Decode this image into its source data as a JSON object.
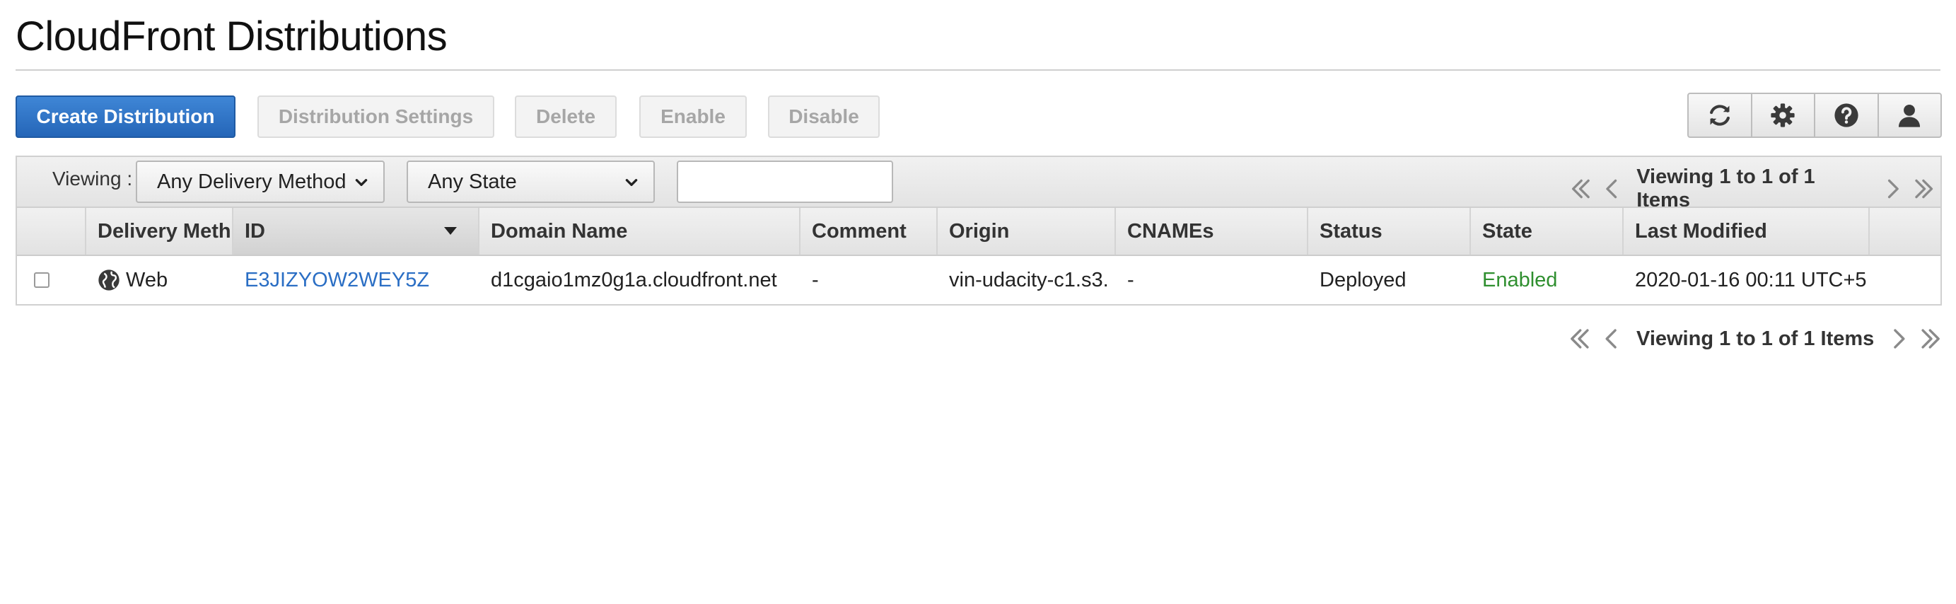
{
  "page": {
    "title": "CloudFront Distributions"
  },
  "toolbar": {
    "create_label": "Create Distribution",
    "settings_label": "Distribution Settings",
    "delete_label": "Delete",
    "enable_label": "Enable",
    "disable_label": "Disable",
    "icons": [
      "refresh-icon",
      "gear-icon",
      "help-icon",
      "user-icon"
    ]
  },
  "filters": {
    "viewing_label": "Viewing :",
    "delivery_method": "Any Delivery Method",
    "state": "Any State",
    "search_value": "",
    "search_placeholder": ""
  },
  "pagination": {
    "summary": "Viewing 1 to 1 of 1 Items"
  },
  "table": {
    "columns": [
      "",
      "Delivery Meth",
      "ID",
      "Domain Name",
      "Comment",
      "Origin",
      "CNAMEs",
      "Status",
      "State",
      "Last Modified",
      ""
    ],
    "sorted_column": "ID",
    "rows": [
      {
        "delivery_method": "Web",
        "id": "E3JIZYOW2WEY5Z",
        "domain_name": "d1cgaio1mz0g1a.cloudfront.net",
        "comment": "-",
        "origin": "vin-udacity-c1.s3.",
        "cnames": "-",
        "status": "Deployed",
        "state": "Enabled",
        "last_modified": "2020-01-16 00:11 UTC+5"
      }
    ]
  },
  "colors": {
    "primary": "#2566b8",
    "link": "#2a6ec4",
    "enabled": "#2f8f2f"
  }
}
